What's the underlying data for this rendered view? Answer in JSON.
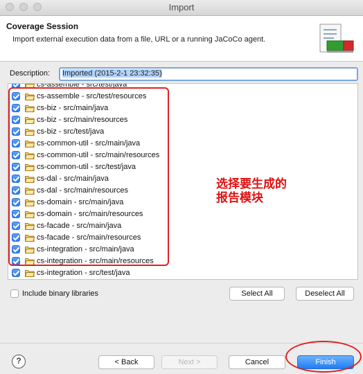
{
  "window": {
    "title": "Import"
  },
  "header": {
    "title": "Coverage Session",
    "description": "Import external execution data from a file, URL or a running JaCoCo agent."
  },
  "description_field": {
    "label": "Description:",
    "value": "Imported (2015-2-1 23:32:35)"
  },
  "items": [
    {
      "label": "cs-assemble - src/test/java",
      "checked": true
    },
    {
      "label": "cs-assemble - src/test/resources",
      "checked": true
    },
    {
      "label": "cs-biz - src/main/java",
      "checked": true
    },
    {
      "label": "cs-biz - src/main/resources",
      "checked": true
    },
    {
      "label": "cs-biz - src/test/java",
      "checked": true
    },
    {
      "label": "cs-common-util - src/main/java",
      "checked": true
    },
    {
      "label": "cs-common-util - src/main/resources",
      "checked": true
    },
    {
      "label": "cs-common-util - src/test/java",
      "checked": true
    },
    {
      "label": "cs-dal - src/main/java",
      "checked": true
    },
    {
      "label": "cs-dal - src/main/resources",
      "checked": true
    },
    {
      "label": "cs-domain - src/main/java",
      "checked": true
    },
    {
      "label": "cs-domain - src/main/resources",
      "checked": true
    },
    {
      "label": "cs-facade - src/main/java",
      "checked": true
    },
    {
      "label": "cs-facade - src/main/resources",
      "checked": true
    },
    {
      "label": "cs-integration - src/main/java",
      "checked": true
    },
    {
      "label": "cs-integration - src/main/resources",
      "checked": true
    },
    {
      "label": "cs-integration - src/test/java",
      "checked": true
    }
  ],
  "annotation": {
    "line1": "选择要生成的",
    "line2": "报告模块"
  },
  "include_binary": {
    "label": "Include binary libraries",
    "checked": false
  },
  "buttons": {
    "select_all": "Select All",
    "deselect_all": "Deselect All",
    "back": "< Back",
    "next": "Next >",
    "cancel": "Cancel",
    "finish": "Finish",
    "help": "?"
  },
  "colors": {
    "accent": "#2a7ef2",
    "annotation_red": "#e02020"
  }
}
